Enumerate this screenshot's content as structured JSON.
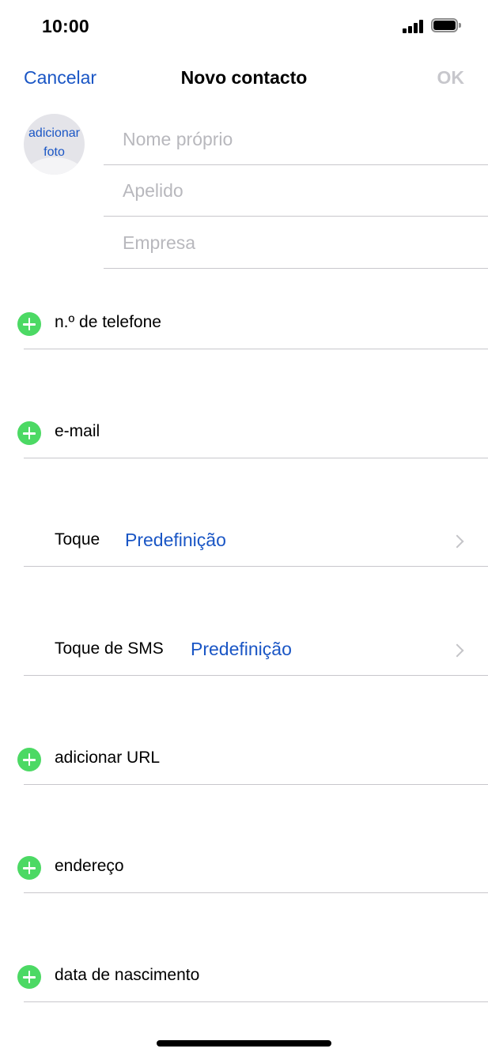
{
  "status_bar": {
    "time": "10:00",
    "signal_icon": "cellular-signal-icon",
    "battery_icon": "battery-icon"
  },
  "nav": {
    "cancel_label": "Cancelar",
    "title": "Novo contacto",
    "ok_label": "OK"
  },
  "avatar": {
    "label": "adicionar foto"
  },
  "name_fields": {
    "first_name_placeholder": "Nome próprio",
    "last_name_placeholder": "Apelido",
    "company_placeholder": "Empresa"
  },
  "rows": {
    "phone_label": "n.º de telefone",
    "email_label": "e-mail",
    "ringtone_label": "Toque",
    "ringtone_value": "Predefinição",
    "sms_tone_label": "Toque de SMS",
    "sms_tone_value": "Predefinição",
    "url_label": "adicionar URL",
    "address_label": "endereço",
    "birthday_label": "data de nascimento"
  },
  "colors": {
    "accent": "#1a56c5",
    "add_green": "#4cd964",
    "disabled": "#c7c7cc",
    "separator": "#c8c7cc"
  }
}
